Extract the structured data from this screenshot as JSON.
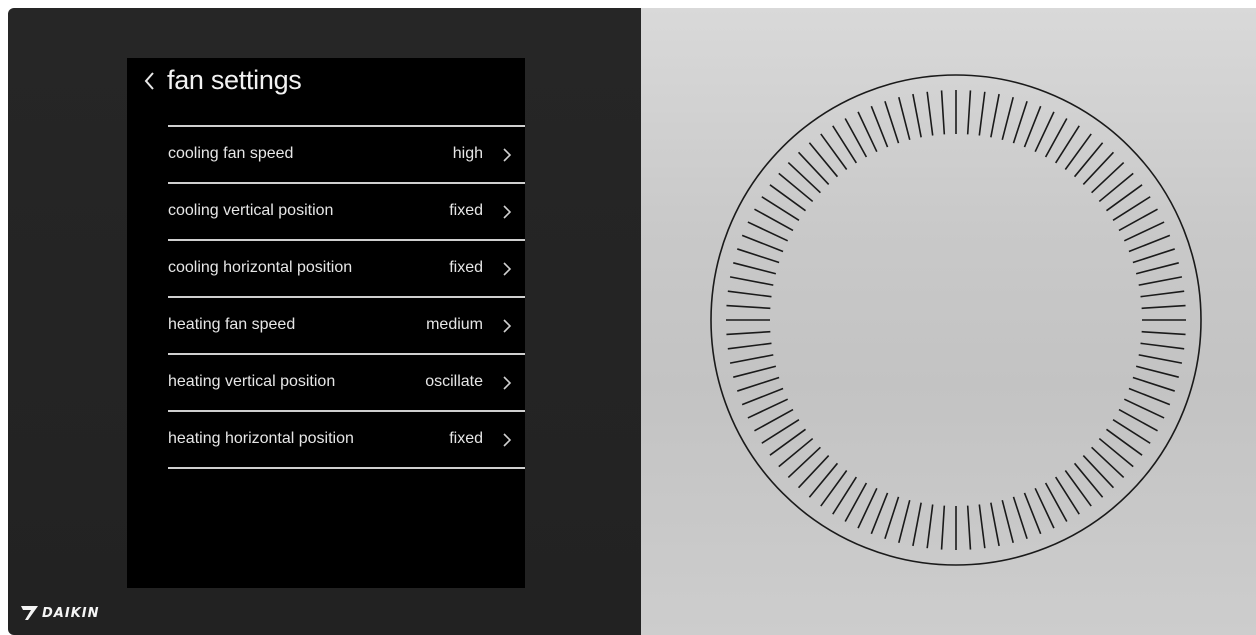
{
  "screen": {
    "title": "fan settings",
    "back_icon": "chevron-left-icon"
  },
  "settings": [
    {
      "label": "cooling fan speed",
      "value": "high"
    },
    {
      "label": "cooling vertical position",
      "value": "fixed"
    },
    {
      "label": "cooling horizontal position",
      "value": "fixed"
    },
    {
      "label": "heating fan speed",
      "value": "medium"
    },
    {
      "label": "heating vertical position",
      "value": "oscillate"
    },
    {
      "label": "heating horizontal position",
      "value": "fixed"
    }
  ],
  "brand": {
    "name": "DAIKIN",
    "logo_icon": "daikin-logo-icon"
  },
  "colors": {
    "device_body": "#242424",
    "screen_bg": "#000000",
    "text": "#e6e6e6",
    "divider": "#cfcfcf",
    "dial_panel": "#c8c8c8",
    "dial_line": "#1a1a1a"
  }
}
